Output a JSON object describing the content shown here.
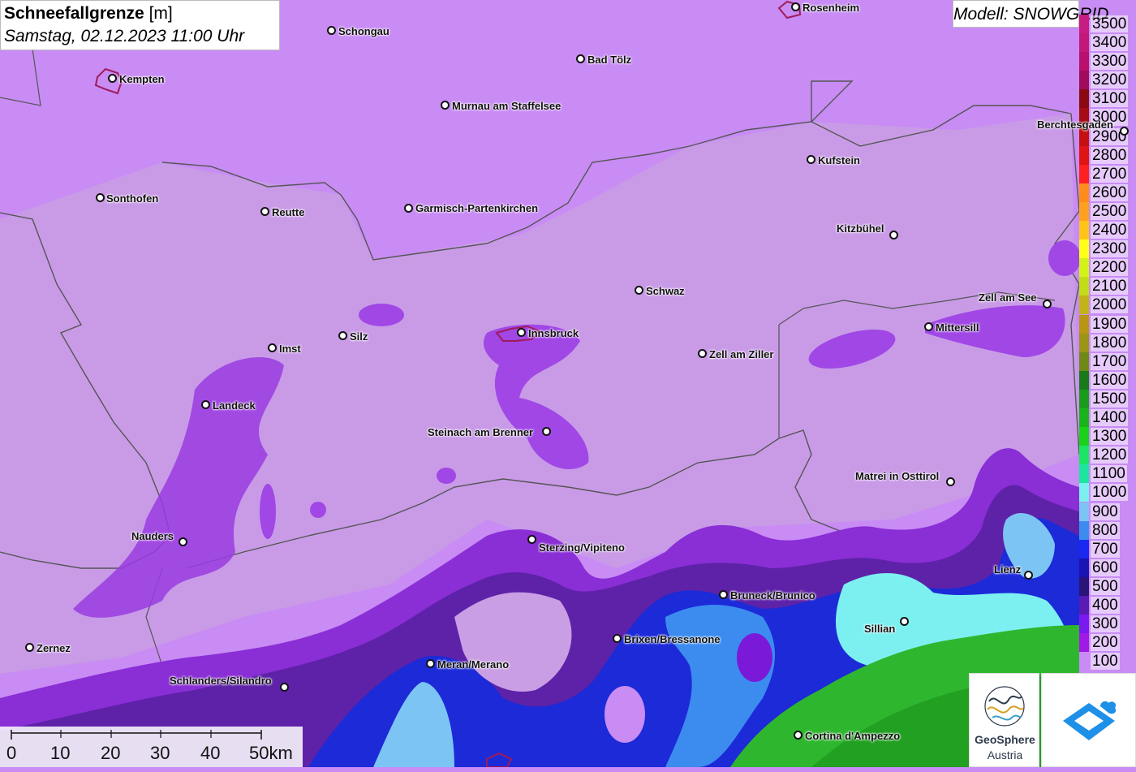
{
  "header": {
    "title_bold": "Schneefallgrenze",
    "title_unit": "[m]",
    "datetime": "Samstag, 02.12.2023 11:00 Uhr",
    "model": "Modell: SNOWGRID"
  },
  "legend": {
    "top_label_partial": "3500",
    "items": [
      {
        "label": "3400",
        "color": "#c2187a"
      },
      {
        "label": "3300",
        "color": "#b8106c"
      },
      {
        "label": "3200",
        "color": "#a00c5c"
      },
      {
        "label": "3100",
        "color": "#8b0a12"
      },
      {
        "label": "3000",
        "color": "#a50d14"
      },
      {
        "label": "2900",
        "color": "#c41010"
      },
      {
        "label": "2800",
        "color": "#df1414"
      },
      {
        "label": "2700",
        "color": "#ff2020"
      },
      {
        "label": "2600",
        "color": "#ff8c1a"
      },
      {
        "label": "2500",
        "color": "#ffa020"
      },
      {
        "label": "2400",
        "color": "#ffc41a"
      },
      {
        "label": "2300",
        "color": "#ffff1a"
      },
      {
        "label": "2200",
        "color": "#d4f21a"
      },
      {
        "label": "2100",
        "color": "#c2dd18"
      },
      {
        "label": "2000",
        "color": "#c2b418"
      },
      {
        "label": "1900",
        "color": "#b89614"
      },
      {
        "label": "1800",
        "color": "#9c9414"
      },
      {
        "label": "1700",
        "color": "#6e8a14"
      },
      {
        "label": "1600",
        "color": "#187a18"
      },
      {
        "label": "1500",
        "color": "#1a9c1a"
      },
      {
        "label": "1400",
        "color": "#1ab41a"
      },
      {
        "label": "1300",
        "color": "#1ad21a"
      },
      {
        "label": "1200",
        "color": "#1ae664"
      },
      {
        "label": "1100",
        "color": "#1ae6a0"
      },
      {
        "label": "1000",
        "color": "#7cf0f0"
      },
      {
        "label": "900",
        "color": "#7cc4f4"
      },
      {
        "label": "800",
        "color": "#3c8cf0"
      },
      {
        "label": "700",
        "color": "#1a28f0"
      },
      {
        "label": "600",
        "color": "#1a14b4"
      },
      {
        "label": "500",
        "color": "#2a1478"
      },
      {
        "label": "400",
        "color": "#5a1ab4"
      },
      {
        "label": "300",
        "color": "#7a1af0"
      },
      {
        "label": "200",
        "color": "#a01ae6"
      },
      {
        "label": "100",
        "color": "#c88cf4"
      }
    ]
  },
  "cities": [
    {
      "name": "Rosenheim"
    },
    {
      "name": "Schongau"
    },
    {
      "name": "Kempten"
    },
    {
      "name": "Bad Tölz"
    },
    {
      "name": "Murnau am Staffelsee"
    },
    {
      "name": "Berchtesgaden"
    },
    {
      "name": "Kufstein"
    },
    {
      "name": "Sonthofen"
    },
    {
      "name": "Reutte"
    },
    {
      "name": "Garmisch-Partenkirchen"
    },
    {
      "name": "Kitzbühel"
    },
    {
      "name": "Schwaz"
    },
    {
      "name": "Zell am See"
    },
    {
      "name": "Mittersill"
    },
    {
      "name": "Imst"
    },
    {
      "name": "Silz"
    },
    {
      "name": "Innsbruck"
    },
    {
      "name": "Zell am Ziller"
    },
    {
      "name": "Landeck"
    },
    {
      "name": "Steinach am Brenner"
    },
    {
      "name": "Matrei in Osttirol"
    },
    {
      "name": "Nauders"
    },
    {
      "name": "Sterzing/Vipiteno"
    },
    {
      "name": "Lienz"
    },
    {
      "name": "Bruneck/Brunico"
    },
    {
      "name": "Sillian"
    },
    {
      "name": "Brixen/Bressanone"
    },
    {
      "name": "Zernez"
    },
    {
      "name": "Meran/Merano"
    },
    {
      "name": "Schlanders/Silandro"
    },
    {
      "name": "Cortina d'Ampezzo"
    }
  ],
  "scalebar": {
    "labels": [
      "0",
      "10",
      "20",
      "30",
      "40",
      "50km"
    ]
  },
  "logos": {
    "geosphere_name": "GeoSphere",
    "geosphere_sub": "Austria"
  }
}
